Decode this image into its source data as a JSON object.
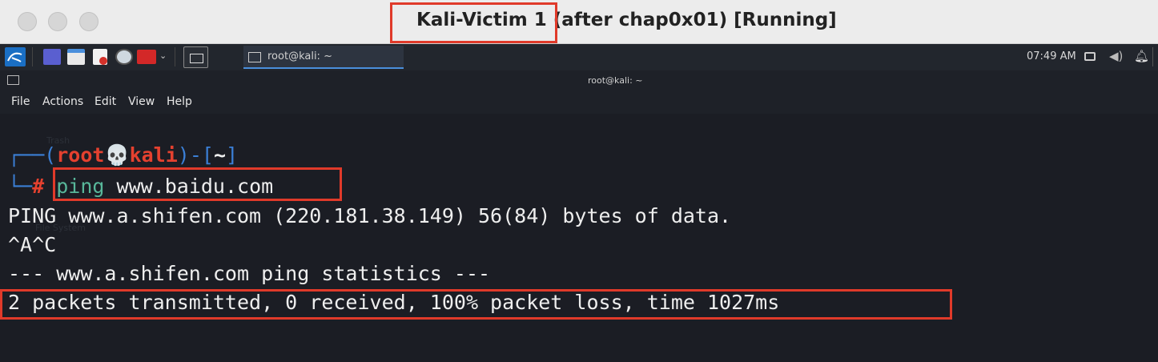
{
  "window": {
    "title_main": "Kali-Victim 1",
    "title_rest": " (after chap0x01) [Running]"
  },
  "panel": {
    "task_label": "root@kali: ~",
    "clock": "07:49 AM"
  },
  "terminal": {
    "title": "root@kali: ~",
    "menu": [
      "File",
      "Actions",
      "Edit",
      "View",
      "Help"
    ],
    "prompt": {
      "open": "┌──(",
      "user": "root",
      "skull": "💀",
      "host": "kali",
      "mid": ")-[",
      "dir": "~",
      "close": "]",
      "corner": "└─",
      "hash": "#",
      "command": "ping",
      "argument": "www.baidu.com"
    },
    "output": [
      "PING www.a.shifen.com (220.181.38.149) 56(84) bytes of data.",
      "^A^C",
      "--- www.a.shifen.com ping statistics ---",
      "2 packets transmitted, 0 received, 100% packet loss, time 1027ms"
    ]
  },
  "desktop": {
    "ghost_labels": [
      "Trash",
      "File System"
    ]
  },
  "colors": {
    "highlight": "#e03a2a",
    "prompt_blue": "#3b7fd6",
    "prompt_red": "#e5412f",
    "command_green": "#58b79a",
    "terminal_bg": "#1b1d24"
  }
}
